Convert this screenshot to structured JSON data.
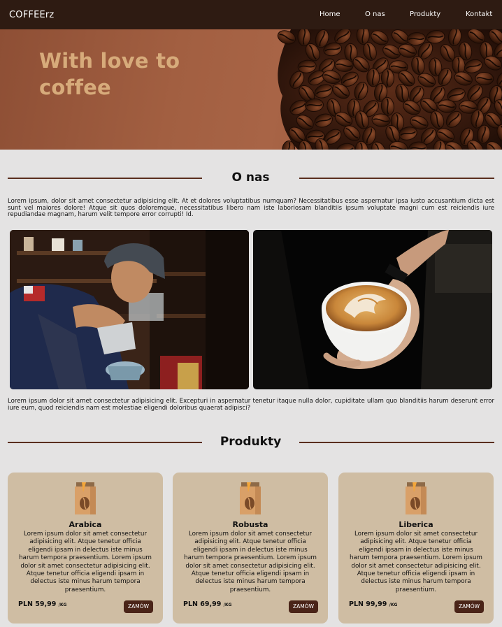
{
  "nav": {
    "brand": "COFFEErz",
    "links": [
      "Home",
      "O nas",
      "Produkty",
      "Kontakt"
    ]
  },
  "hero": {
    "title": "With love to coffee"
  },
  "about": {
    "title": "O nas",
    "para1": "Lorem ipsum, dolor sit amet consectetur adipisicing elit. At et dolores voluptatibus numquam? Necessitatibus esse aspernatur ipsa iusto accusantium dicta est sunt vel maiores dolore! Atque sit quos doloremque, necessitatibus libero nam iste laboriosam blanditiis ipsum voluptate magni cum est reiciendis iure repudiandae magnam, harum velit tempore error corrupti! Id.",
    "para2": "Lorem ipsum dolor sit amet consectetur adipisicing elit. Excepturi in aspernatur tenetur itaque nulla dolor, cupiditate ullam quo blanditiis harum deserunt error iure eum, quod reiciendis nam est molestiae eligendi doloribus quaerat adipisci?"
  },
  "products": {
    "title": "Produkty",
    "items": [
      {
        "name": "Arabica",
        "desc": "Lorem ipsum dolor sit amet consectetur adipisicing elit. Atque tenetur officia eligendi ipsam in delectus iste minus harum tempora praesentium. Lorem ipsum dolor sit amet consectetur adipisicing elit. Atque tenetur officia eligendi ipsam in delectus iste minus harum tempora praesentium.",
        "price": "PLN 59,99",
        "unit": "/KG",
        "button": "ZAMÓW"
      },
      {
        "name": "Robusta",
        "desc": "Lorem ipsum dolor sit amet consectetur adipisicing elit. Atque tenetur officia eligendi ipsam in delectus iste minus harum tempora praesentium. Lorem ipsum dolor sit amet consectetur adipisicing elit. Atque tenetur officia eligendi ipsam in delectus iste minus harum tempora praesentium.",
        "price": "PLN 69,99",
        "unit": "/KG",
        "button": "ZAMÓW"
      },
      {
        "name": "Liberica",
        "desc": "Lorem ipsum dolor sit amet consectetur adipisicing elit. Atque tenetur officia eligendi ipsam in delectus iste minus harum tempora praesentium. Lorem ipsum dolor sit amet consectetur adipisicing elit. Atque tenetur officia eligendi ipsam in delectus iste minus harum tempora praesentium.",
        "price": "PLN 99,99",
        "unit": "/KG",
        "button": "ZAMÓW"
      }
    ]
  },
  "colors": {
    "nav_bg": "#2e1b12",
    "accent": "#5a2e1e",
    "hero_text": "#d7ab7b",
    "card_bg": "#cfbda3",
    "button_bg": "#4a2418"
  }
}
